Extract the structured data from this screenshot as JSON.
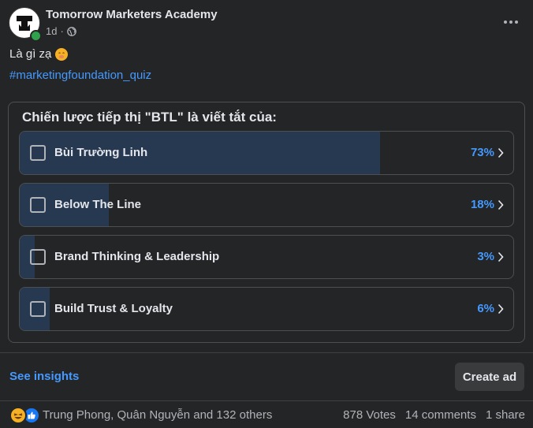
{
  "header": {
    "page_name": "Tomorrow Marketers Academy",
    "time": "1d",
    "privacy_icon": "globe-icon",
    "more_icon": "ellipsis-icon"
  },
  "post": {
    "text": "Là gì zạ",
    "emoji": "face-with-hand-over-mouth",
    "hashtag": "#marketingfoundation_quiz"
  },
  "poll": {
    "question": "Chiến lược tiếp thị \"BTL\" là viết tắt của:",
    "options": [
      {
        "label": "Bùi Trường Linh",
        "percent": "73%",
        "share": 0.73
      },
      {
        "label": "Below The Line",
        "percent": "18%",
        "share": 0.18
      },
      {
        "label": "Brand Thinking & Leadership",
        "percent": "3%",
        "share": 0.03
      },
      {
        "label": "Build Trust & Loyalty",
        "percent": "6%",
        "share": 0.06
      }
    ]
  },
  "actions": {
    "see_insights": "See insights",
    "create_ad": "Create ad"
  },
  "footer": {
    "reactions": [
      "haha",
      "like"
    ],
    "reacted_by": "Trung Phong, Quân Nguyễn and 132 others",
    "votes": "878 Votes",
    "comments": "14 comments",
    "shares": "1 share"
  },
  "colors": {
    "background": "#242526",
    "accent": "#4599ff",
    "poll_fill": "#263951",
    "online": "#31a24c"
  }
}
